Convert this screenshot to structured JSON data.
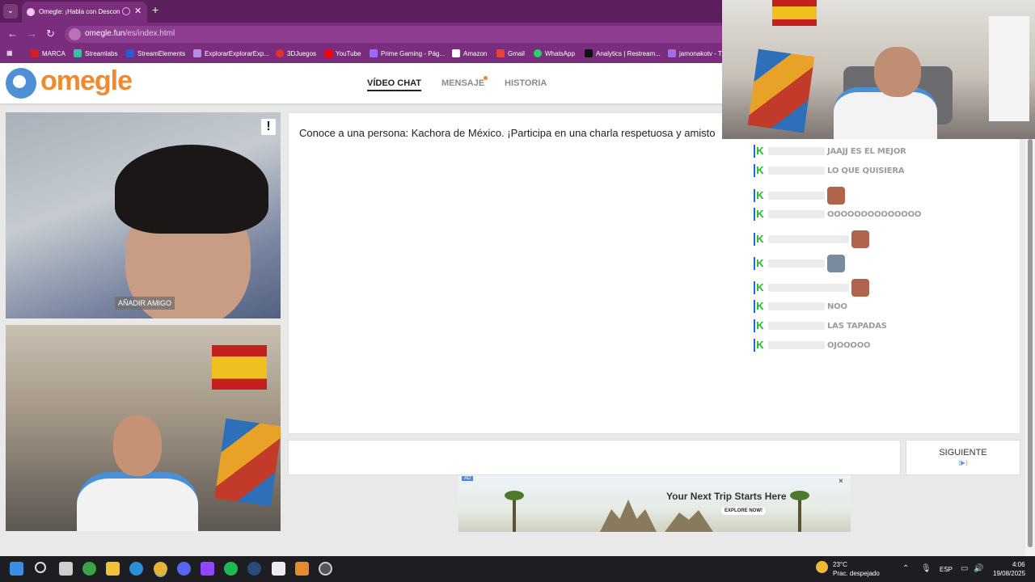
{
  "browser": {
    "tab_title": "Omegle: ¡Habla con Descon",
    "url_host": "omegle.fun",
    "url_path": "/es/index.html",
    "bookmarks": [
      "MARCA",
      "Streamlabs",
      "StreamElements",
      "ExplorarExplorarExp...",
      "3DJuegos",
      "YouTube",
      "Prime Gaming - Pág...",
      "Amazon",
      "Gmail",
      "WhatsApp",
      "Analytics | Restream...",
      "jamonakotv - T"
    ]
  },
  "site": {
    "logo": "omegle",
    "nav": [
      "VÍDEO CHAT",
      "MENSAJE",
      "HISTORIA"
    ]
  },
  "video": {
    "add_friend": "AÑADIR AMIGO",
    "report_icon": "!"
  },
  "chat": {
    "intro": "Conoce a una persona: Kachora de México. ¡Participa en una charla respetuosa y amisto"
  },
  "controls": {
    "next_label": "SIGUIENTE",
    "next_hint": "(▶)"
  },
  "ad": {
    "tag": "AD",
    "headline": "Your Next Trip Starts Here",
    "cta": "EXPLORE NOW!",
    "close": "×"
  },
  "stream_chat": [
    {
      "msg": "JAAJJ ES EL MEJOR",
      "emote": false
    },
    {
      "msg": "LO QUE QUISIERA",
      "emote": false
    },
    {
      "msg": "",
      "emote": true
    },
    {
      "msg": "OOOOOOOOOOOOOO",
      "emote": false
    },
    {
      "msg": "",
      "emote": true
    },
    {
      "msg": "",
      "emote": true
    },
    {
      "msg": "",
      "emote": true
    },
    {
      "msg": "NOO",
      "emote": false
    },
    {
      "msg": "LAS TAPADAS",
      "emote": false
    },
    {
      "msg": "OJOOOOO",
      "emote": false
    }
  ],
  "taskbar": {
    "temp": "23°C",
    "weather": "Prac. despejado",
    "lang": "ESP",
    "time": "4:06",
    "date": "19/08/2025"
  }
}
